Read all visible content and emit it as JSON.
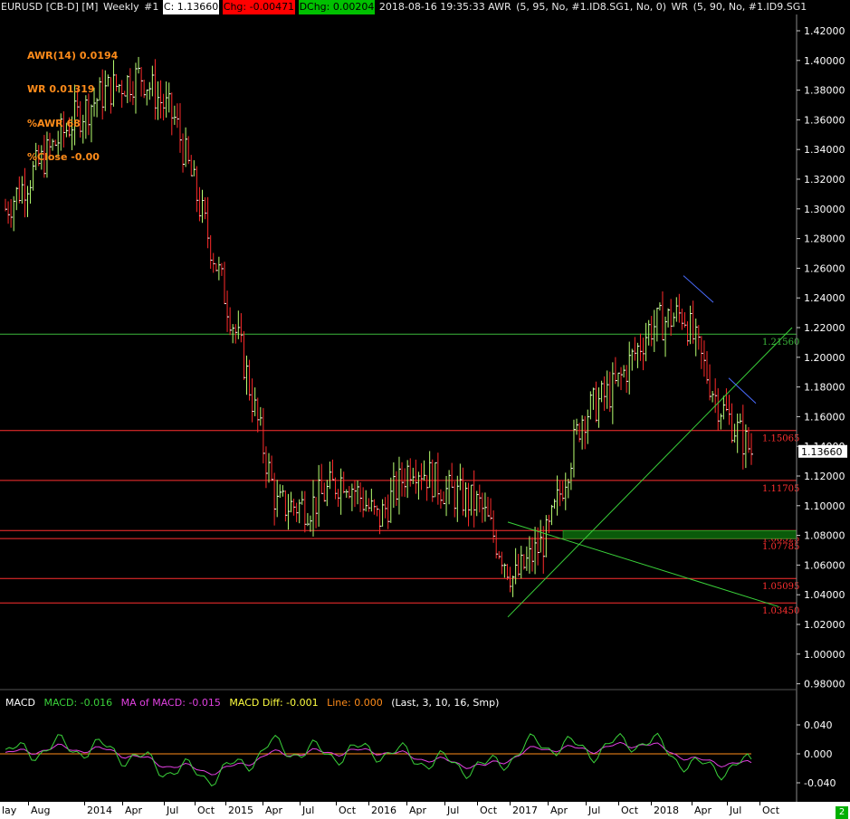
{
  "header": {
    "symbol": "EURUSD [CB-D] [M]",
    "timeframe": "Weekly",
    "window_num": "#1",
    "close": "C: 1.13660",
    "change": "Chg: -0.00471",
    "dchange": "DChg: 0.00204",
    "timestamp": "2018-08-16 19:35:33 AWR",
    "study1": "(5, 95, No, #1.ID8.SG1, No, 0)",
    "study2_name": "WR",
    "study2": "(5, 90, No, #1.ID9.SG1"
  },
  "indicators": {
    "awr": "AWR(14) 0.0194",
    "wr": "WR 0.01319",
    "pawr": "%AWR 68",
    "pclose": "%Close -0.00"
  },
  "price_axis": {
    "ticks": [
      "1.42000",
      "1.40000",
      "1.38000",
      "1.36000",
      "1.34000",
      "1.32000",
      "1.30000",
      "1.28000",
      "1.26000",
      "1.24000",
      "1.22000",
      "1.20000",
      "1.18000",
      "1.16000",
      "1.14000",
      "1.12000",
      "1.10000",
      "1.08000",
      "1.06000",
      "1.04000",
      "1.02000",
      "1.00000",
      "0.98000"
    ],
    "last_price": "1.13660"
  },
  "levels": [
    {
      "label": "1.21560",
      "color": "#3cb83c"
    },
    {
      "label": "1.15065",
      "color": "#ff3030"
    },
    {
      "label": "1.11705",
      "color": "#ff3030"
    },
    {
      "label": "1.08325",
      "color": "#ff3030"
    },
    {
      "label": "1.07785",
      "color": "#ff3030"
    },
    {
      "label": "1.05095",
      "color": "#ff3030"
    },
    {
      "label": "1.03450",
      "color": "#ff3030"
    }
  ],
  "macd": {
    "title": "MACD",
    "macd": "MACD: -0.016",
    "ma": "MA of MACD: -0.015",
    "diff": "MACD Diff: -0.001",
    "line": "Line: 0.000",
    "params": "(Last, 3, 10, 16, Smp)",
    "ticks": [
      "0.040",
      "0.000",
      "-0.040"
    ]
  },
  "time_axis": {
    "labels": [
      "lay",
      "Aug",
      "2014",
      "Apr",
      "Jul",
      "Oct",
      "2015",
      "Apr",
      "Jul",
      "Oct",
      "2016",
      "Apr",
      "Jul",
      "Oct",
      "2017",
      "Apr",
      "Jul",
      "Oct",
      "2018",
      "Apr",
      "Jul",
      "Oct"
    ]
  },
  "status_badge": "2",
  "colors": {
    "up_bar": "#b8ff70",
    "down_bar": "#ff2a2a",
    "macd_line": "#3ad23a",
    "ma_line": "#e040e0",
    "trend_blue": "#4a6cff",
    "trend_green": "#3ad23a",
    "zone": "#0a5a0a"
  },
  "chart_data": {
    "type": "ohlc",
    "x": [
      "2013-05",
      "2013-08",
      "2013-11",
      "2014-01",
      "2014-04",
      "2014-07",
      "2014-10",
      "2015-01",
      "2015-04",
      "2015-07",
      "2015-10",
      "2016-01",
      "2016-04",
      "2016-07",
      "2016-10",
      "2017-01",
      "2017-04",
      "2017-07",
      "2017-10",
      "2018-01",
      "2018-04",
      "2018-07",
      "2018-08"
    ],
    "close": [
      1.3,
      1.33,
      1.36,
      1.38,
      1.39,
      1.36,
      1.28,
      1.2,
      1.1,
      1.1,
      1.12,
      1.09,
      1.13,
      1.11,
      1.1,
      1.05,
      1.08,
      1.16,
      1.18,
      1.22,
      1.23,
      1.17,
      1.1366
    ],
    "ylim": [
      0.97,
      1.43
    ],
    "macd": {
      "x": [
        "2013-05",
        "2013-11",
        "2014-04",
        "2014-10",
        "2015-01",
        "2015-04",
        "2015-10",
        "2016-04",
        "2016-10",
        "2017-01",
        "2017-07",
        "2017-10",
        "2018-02",
        "2018-06",
        "2018-08"
      ],
      "macd": [
        0.0,
        0.01,
        0.005,
        -0.02,
        -0.03,
        0.01,
        0.0,
        0.005,
        -0.01,
        -0.02,
        0.015,
        0.005,
        0.02,
        -0.02,
        -0.016
      ],
      "ma": [
        0.0,
        0.008,
        0.004,
        -0.015,
        -0.025,
        0.0,
        0.002,
        0.004,
        -0.008,
        -0.018,
        0.008,
        0.006,
        0.015,
        -0.01,
        -0.015
      ],
      "ylim": [
        -0.05,
        0.05
      ]
    }
  }
}
